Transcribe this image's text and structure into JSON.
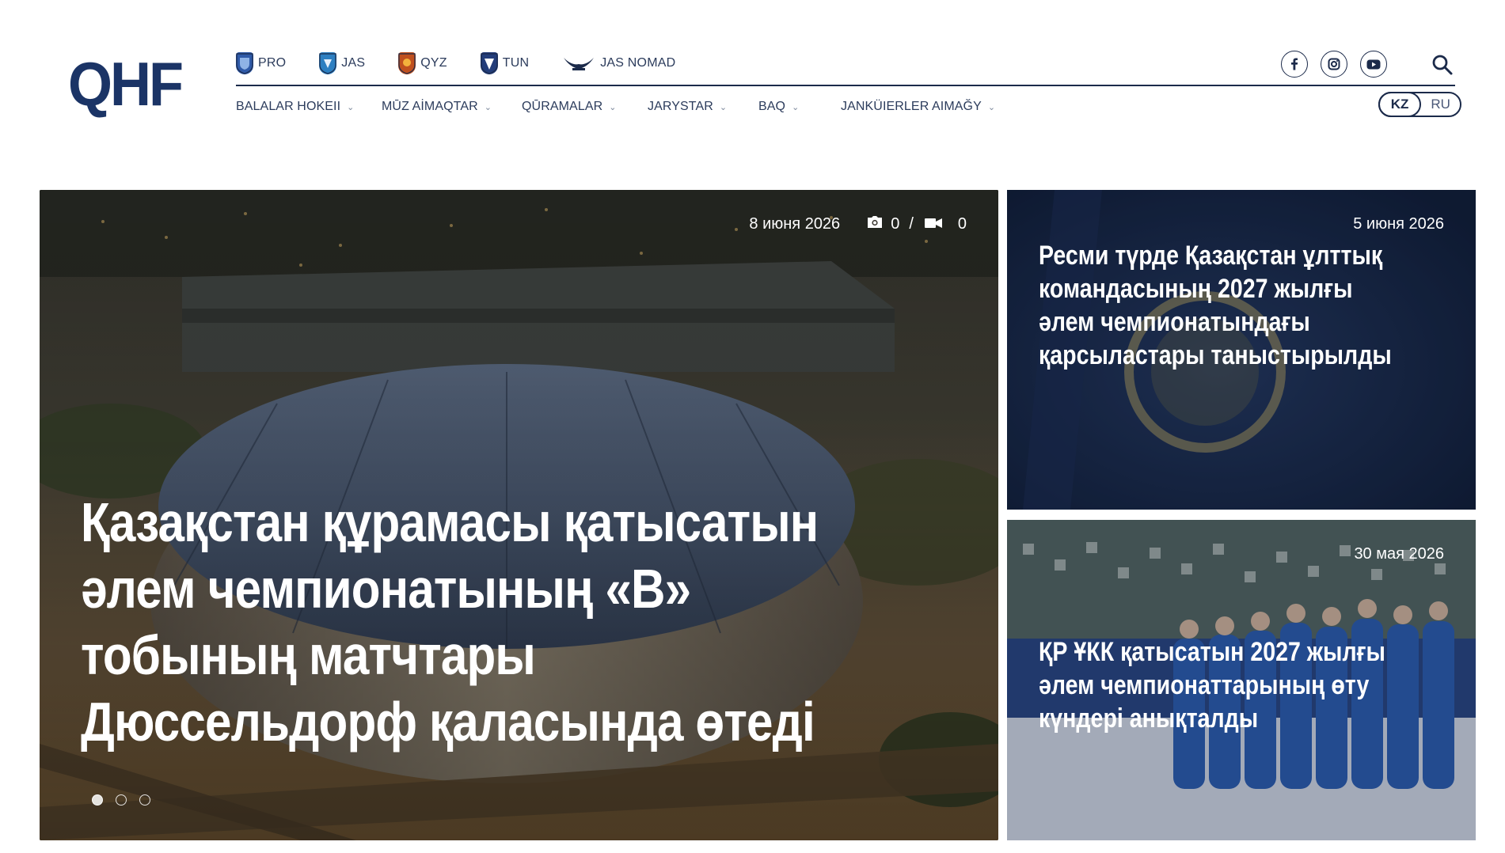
{
  "brand": {
    "logo_text": "QHF"
  },
  "leagues": [
    {
      "label": "PRO",
      "icon": "pro-shield-icon",
      "color": "#2f5aa8"
    },
    {
      "label": "JAS",
      "icon": "jas-shield-icon",
      "color": "#2d7fc1"
    },
    {
      "label": "QYZ",
      "icon": "qyz-shield-icon",
      "color": "#c0501e"
    },
    {
      "label": "TUN",
      "icon": "tun-shield-icon",
      "color": "#233d7a"
    },
    {
      "label": "JAS NOMAD",
      "icon": "jas-nomad-wings-icon",
      "color": "#1b2a4a"
    }
  ],
  "nav": [
    {
      "label": "BALALAR HOKEII"
    },
    {
      "label": "MŪZ AİMAQTAR"
    },
    {
      "label": "QŪRAMALAR"
    },
    {
      "label": "JARYSTAR"
    },
    {
      "label": "BAQ"
    },
    {
      "label": "JANKÜIERLER AIMAĞY"
    }
  ],
  "socials": [
    {
      "icon": "facebook-icon"
    },
    {
      "icon": "instagram-icon"
    },
    {
      "icon": "youtube-icon"
    }
  ],
  "search": {
    "icon": "search-icon"
  },
  "languages": {
    "active": "KZ",
    "other": "RU"
  },
  "hero": {
    "date": "8 июня 2026",
    "photos": "0",
    "videos": "0",
    "separator": "/",
    "title": "Қазақстан құрамасы қатысатын әлем чемпионатының «В» тобының матчтары Дюссельдорф қаласында өтеді",
    "slides": [
      true,
      false,
      false
    ]
  },
  "cards": [
    {
      "date": "5 июня 2026",
      "title": "Ресми түрде Қазақстан ұлттық командасының 2027 жылғы әлем чемпионатындағы қарсыластары таныстырылды"
    },
    {
      "date": "30 мая 2026",
      "title": "ҚР ҰКК қатысатын 2027 жылғы әлем чемпионаттарының өту күндері анықталды"
    }
  ],
  "colors": {
    "navy": "#1b2a4a",
    "accent": "#1b3466"
  }
}
